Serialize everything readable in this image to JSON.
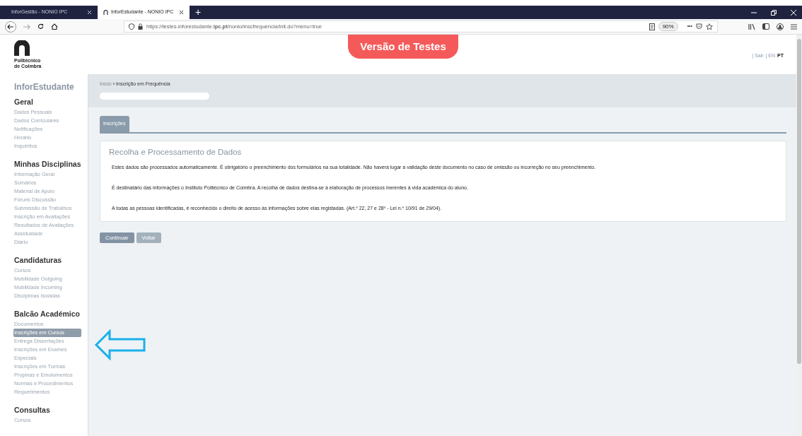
{
  "browser": {
    "tabs": [
      {
        "title": "InforGestão - NONIO IPC",
        "selected": false
      },
      {
        "title": "InforEstudante - NONIO IPC",
        "selected": true
      }
    ],
    "new_tab": "+",
    "url": "https://testes-inforestudante.**ipc.pt**/nonio/inscfrequencia/init.do?menu=true",
    "zoom": "90%",
    "more": "•••"
  },
  "header": {
    "logo_text": [
      "Politécnico",
      "de Coimbra"
    ],
    "banner": "Versão de Testes",
    "links": [
      {
        "label": "| Sair",
        "kind": "link"
      },
      {
        "label": "| EN",
        "kind": "lang",
        "selected": false
      },
      {
        "label": "PT",
        "kind": "lang",
        "selected": true
      }
    ]
  },
  "sidebar": {
    "title": "InforEstudante",
    "sections": [
      {
        "title": "Geral",
        "items": [
          {
            "label": "Dados Pessoais",
            "selected": false
          },
          {
            "label": "Dados Curriculares",
            "selected": false
          },
          {
            "label": "Notificações",
            "selected": false
          },
          {
            "label": "Horário",
            "selected": false
          },
          {
            "label": "Inquéritos",
            "selected": false
          }
        ]
      },
      {
        "title": "Minhas Disciplinas",
        "items": [
          {
            "label": "Informação Geral",
            "selected": false
          },
          {
            "label": "Sumários",
            "selected": false
          },
          {
            "label": "Material de Apoio",
            "selected": false
          },
          {
            "label": "Fóruns Discussão",
            "selected": false
          },
          {
            "label": "Submissão de Trabalhos",
            "selected": false
          },
          {
            "label": "Inscrição em Avaliações",
            "selected": false
          },
          {
            "label": "Resultados de Avaliações",
            "selected": false
          },
          {
            "label": "Assiduidade",
            "selected": false
          },
          {
            "label": "Diário",
            "selected": false
          }
        ]
      },
      {
        "title": "Candidaturas",
        "items": [
          {
            "label": "Cursos",
            "selected": false
          },
          {
            "label": "Mobilidade Outgoing",
            "selected": false
          },
          {
            "label": "Mobilidade Incoming",
            "selected": false
          },
          {
            "label": "Disciplinas Isoladas",
            "selected": false
          }
        ]
      },
      {
        "title": "Balcão Académico",
        "items": [
          {
            "label": "Documentos",
            "selected": false
          },
          {
            "label": "Inscrições em Cursos",
            "selected": true
          },
          {
            "label": "Entrega Dissertações",
            "selected": false
          },
          {
            "label": "Inscrições em Exames Especiais",
            "selected": false
          },
          {
            "label": "Inscrições em Turmas",
            "selected": false
          },
          {
            "label": "Propinas e Emolumentos",
            "selected": false
          },
          {
            "label": "Normas e Procedimentos",
            "selected": false
          },
          {
            "label": "Requerimentos",
            "selected": false
          }
        ]
      },
      {
        "title": "Consultas",
        "items": [
          {
            "label": "Cursos",
            "selected": false
          }
        ]
      }
    ]
  },
  "breadcrumb": [
    {
      "label": "Início",
      "current": false
    },
    {
      "label": "Inscrição em Frequência",
      "current": true
    }
  ],
  "breadcrumb_separator": "›",
  "tabs": [
    {
      "label": "Inscrições",
      "selected": true
    }
  ],
  "card": {
    "title": "Recolha e Processamento de Dados",
    "paragraphs": [
      "Estes dados são processados automaticamente. É obrigatório o preenchimento dos formulários na sua totalidade. Não haverá lugar à validação deste documento no caso de omissão ou incorreção no seu preenchimento.",
      "É destinatário das informações o Instituto Politécnico de Coimbra. A recolha de dados destina-se à elaboração de processos inerentes à vida académica do aluno.",
      "A todas as pessoas identificadas, é reconhecido o direito de acesso às informações sobre elas registadas. (Art.º 22, 27 e 28º - Lei n.º 10/91 de 29/04)."
    ]
  },
  "buttons": [
    {
      "label": "Continuar",
      "disabled": false
    },
    {
      "label": "Voltar",
      "disabled": true
    }
  ]
}
